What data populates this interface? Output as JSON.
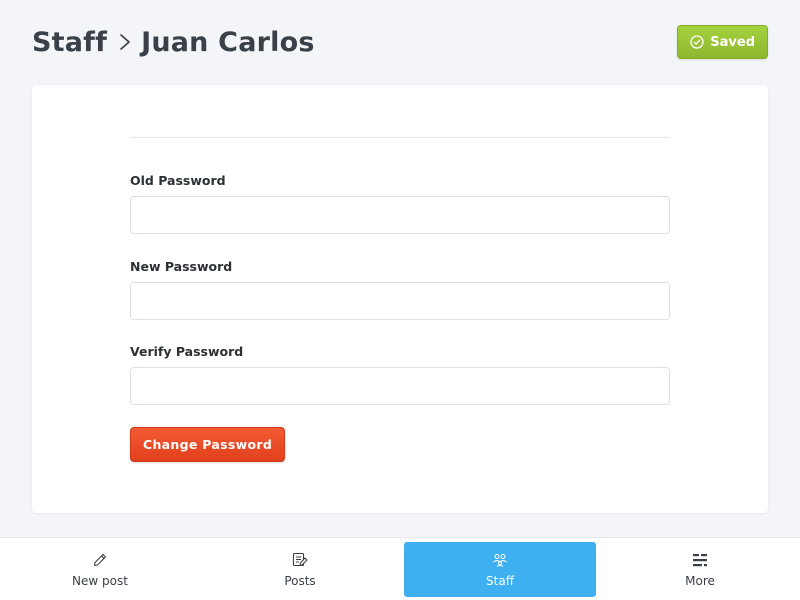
{
  "header": {
    "breadcrumb_parent": "Staff",
    "breadcrumb_current": "Juan Carlos",
    "saved_label": "Saved"
  },
  "form": {
    "old_password": {
      "label": "Old Password",
      "value": ""
    },
    "new_password": {
      "label": "New Password",
      "value": ""
    },
    "verify_password": {
      "label": "Verify Password",
      "value": ""
    },
    "submit_label": "Change Password"
  },
  "nav": {
    "items": [
      {
        "label": "New post",
        "icon": "pencil-icon"
      },
      {
        "label": "Posts",
        "icon": "posts-icon"
      },
      {
        "label": "Staff",
        "icon": "staff-icon",
        "active": true
      },
      {
        "label": "More",
        "icon": "more-icon"
      }
    ]
  },
  "colors": {
    "saved_green": "#9cc63a",
    "danger_red": "#e9481f",
    "active_blue": "#3eb0ef"
  }
}
